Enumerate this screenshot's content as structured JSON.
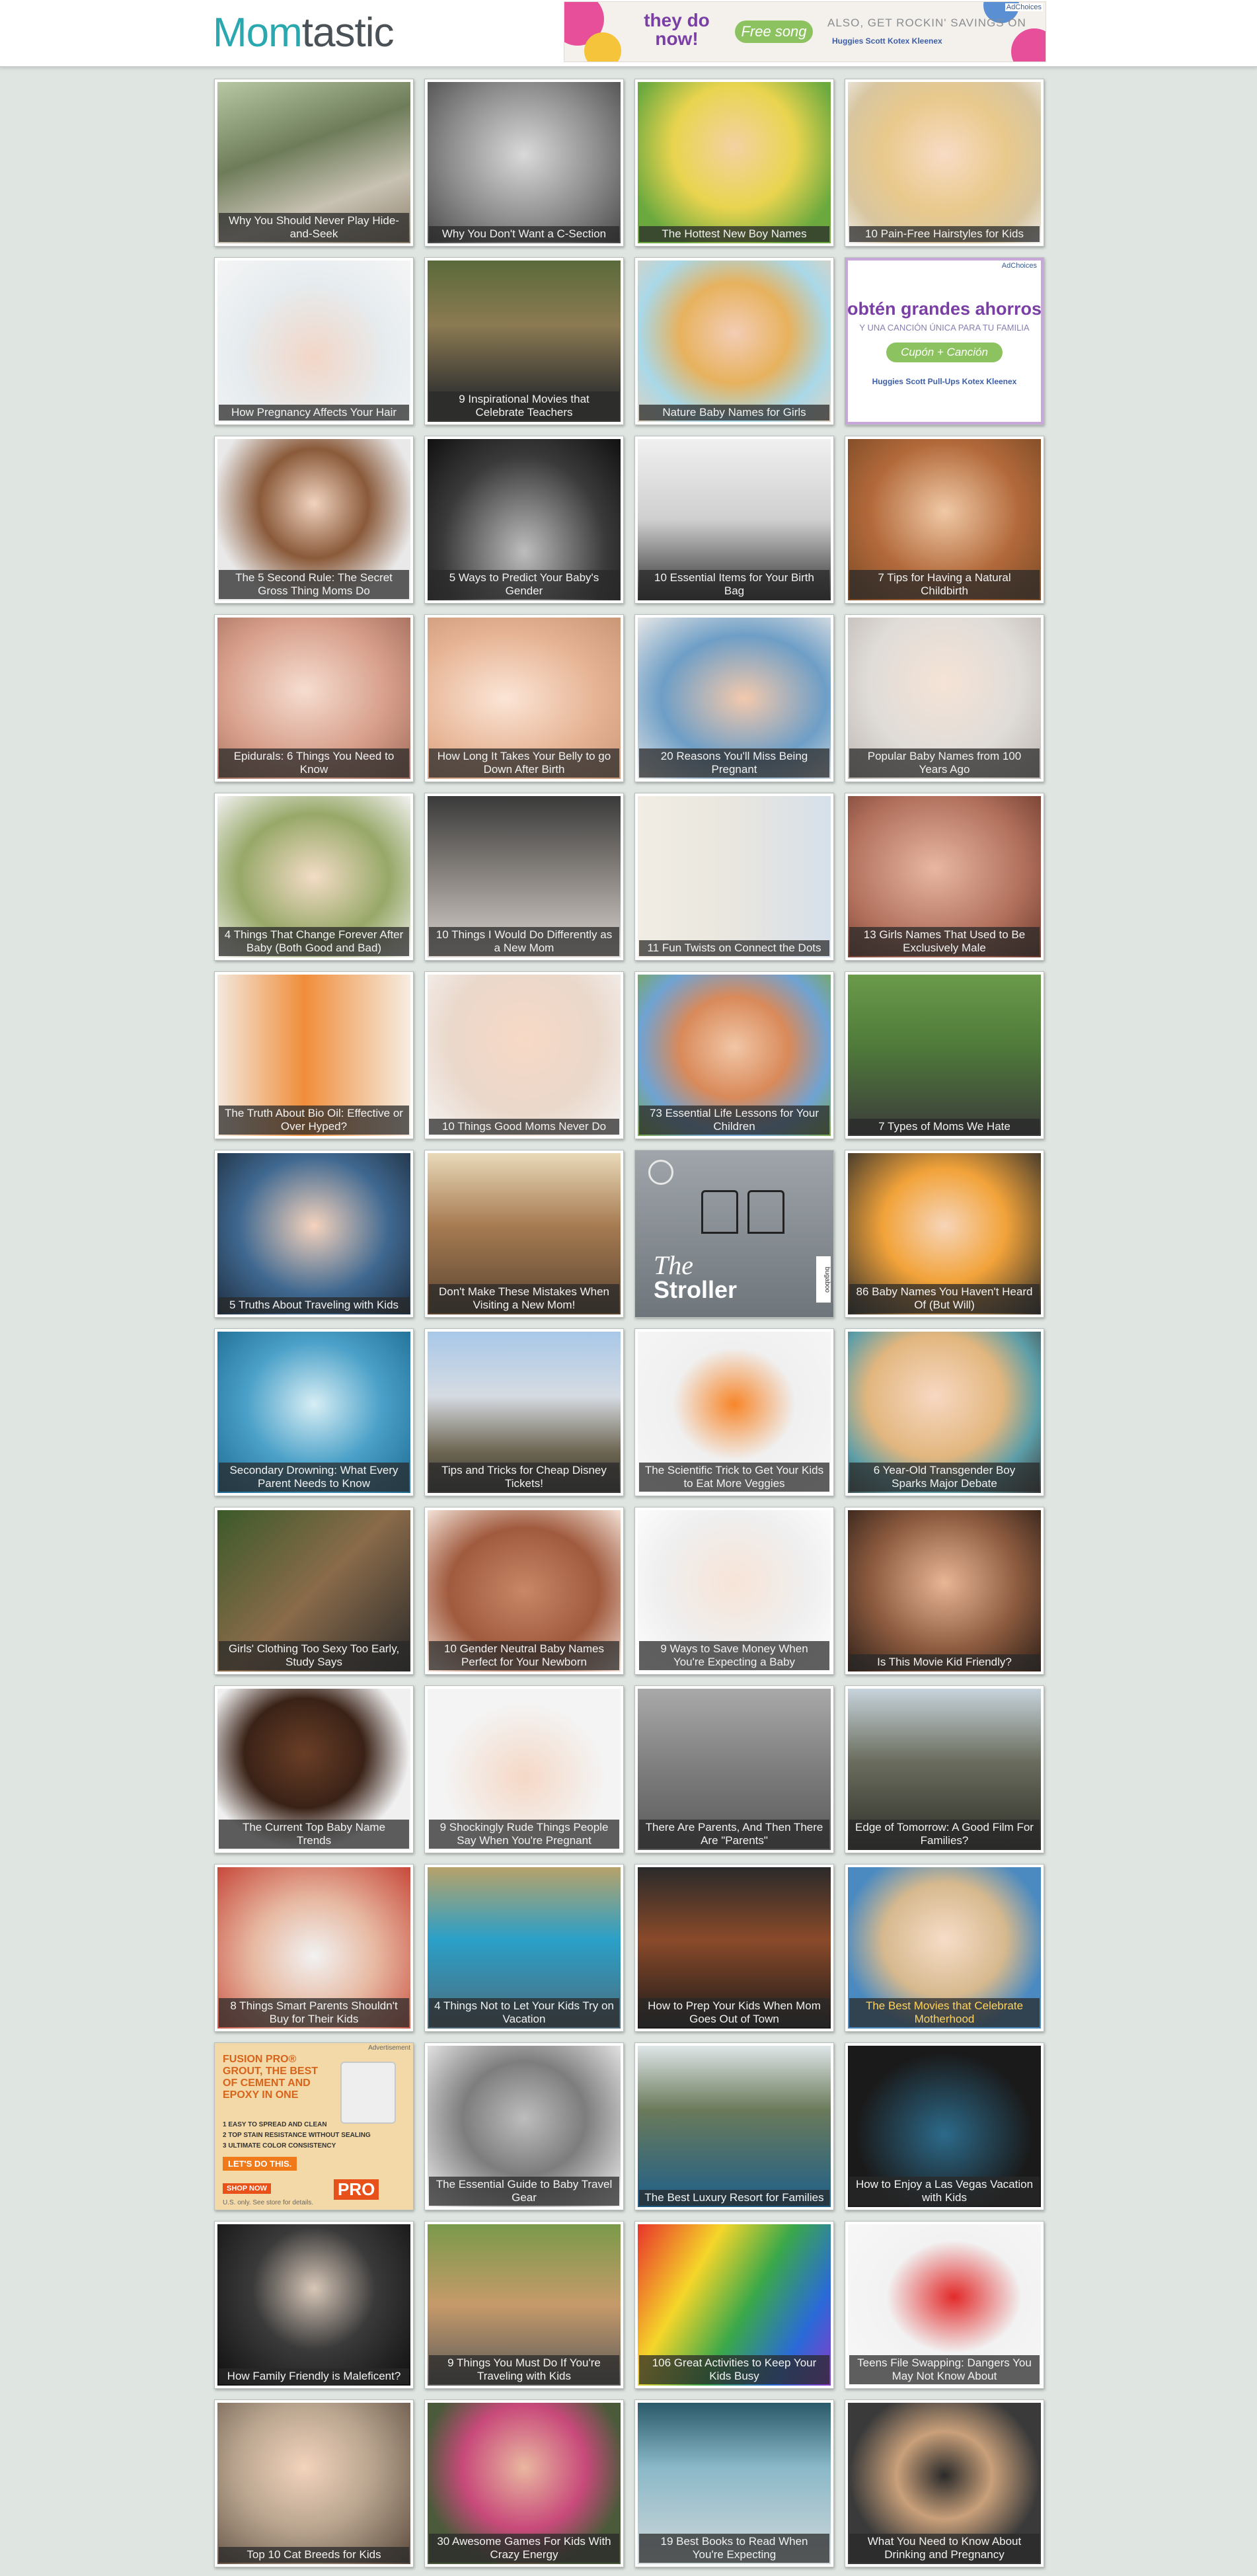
{
  "header": {
    "logo_part1": "Mom",
    "logo_part2": "tastic",
    "ad": {
      "adchoices": "AdChoices",
      "headline": "they do now!",
      "pill": "Free song",
      "tagline": "ALSO, GET ROCKIN' SAVINGS ON",
      "brands": "Huggies  Scott  Kotex  Kleenex"
    }
  },
  "colors": {
    "brand_teal": "#2aa8b0",
    "page_bg": "#dfe5e1",
    "caption_bg": "#3a3a3a"
  },
  "tiles": [
    {
      "caption": "Why You Should Never Play Hide-and-Seek",
      "bg": "linear-gradient(160deg,#b7c7a3,#6e7c5a 40%,#c8c2b2 70%,#8a7d6b)"
    },
    {
      "caption": "Why You Don't Want a C-Section",
      "bg": "radial-gradient(ellipse at 50% 45%,#d9d9d9,#8d8d8d 55%,#4a4a4a)"
    },
    {
      "caption": "The Hottest New Boy Names",
      "bg": "radial-gradient(ellipse at 50% 40%,#f4d2a2,#e9d44f 45%,#6ba93f 80%)"
    },
    {
      "caption": "10 Pain-Free Hairstyles for Kids",
      "bg": "radial-gradient(ellipse at 50% 45%,#f8dcc5,#e9c98c 45%,#d8c6a0 75%,#efefef)"
    },
    {
      "caption": "How Pregnancy Affects Your Hair",
      "bg": "radial-gradient(ellipse at 50% 60%,#f2d6c7,#e6ecef 55%,#f5f5f5)"
    },
    {
      "caption": "9 Inspirational Movies that Celebrate Teachers",
      "bg": "linear-gradient(180deg,#5a6a3a,#8b7a52 40%,#3c3a35 80%)"
    },
    {
      "caption": "Nature Baby Names for Girls",
      "bg": "radial-gradient(ellipse at 50% 45%,#f3cdb5,#e7b25e 40%,#a9d8e8 70%,#e0d2c0)"
    },
    {
      "ad": "sidebar_ad"
    },
    {
      "caption": "The 5 Second Rule: The Secret Gross Thing Moms Do",
      "bg": "radial-gradient(ellipse at 50% 40%,#f1d3bf,#8a5a3a 40%,#e9e9e9 75%)"
    },
    {
      "caption": "5 Ways to Predict Your Baby's Gender",
      "bg": "radial-gradient(ellipse at 50% 70%,#bdbdbd,#3a3a3a 60%,#111)"
    },
    {
      "caption": "10 Essential Items for Your Birth Bag",
      "bg": "linear-gradient(180deg,#f0f0f0,#cfcfcf 50%,#2c2c2c)"
    },
    {
      "caption": "7 Tips for Having a Natural Childbirth",
      "bg": "radial-gradient(ellipse at 50% 45%,#f0c9a6,#b2693a 55%,#7a4a26)"
    },
    {
      "caption": "Epidurals: 6 Things You Need to Know",
      "bg": "radial-gradient(ellipse at 45% 45%,#f6ddd0,#d79f8b 55%,#a06a5a)"
    },
    {
      "caption": "How Long It Takes Your Belly to go Down After Birth",
      "bg": "radial-gradient(ellipse at 40% 50%,#fbe5d6,#e7b596 55%,#c99676)"
    },
    {
      "caption": "20 Reasons You'll Miss Being Pregnant",
      "bg": "radial-gradient(ellipse at 55% 50%,#f3c9ad,#6e9ec6 55%,#e6e6e6)"
    },
    {
      "caption": "Popular Baby Names from 100 Years Ago",
      "bg": "radial-gradient(ellipse at 50% 40%,#f5e3d6,#e0dcd8 55%,#bdb7b2)"
    },
    {
      "caption": "4 Things That Change Forever After Baby (Both Good and Bad)",
      "bg": "radial-gradient(ellipse at 50% 50%,#f3dcc6,#97a868 55%,#f2f2f2)"
    },
    {
      "caption": "10 Things I Would Do Differently as a New Mom",
      "bg": "linear-gradient(180deg,#3a3a3a,#8a8580 50%,#d9d4cf)"
    },
    {
      "caption": "11 Fun Twists on Connect the Dots",
      "bg": "linear-gradient(90deg,#f1ede4,#e9e6df 50%,#d6e0ea)"
    },
    {
      "caption": "13 Girls Names That Used to Be Exclusively Male",
      "bg": "radial-gradient(ellipse at 45% 45%,#e8b7a2,#b06f5b 60%,#6e3b2e)"
    },
    {
      "caption": "The Truth About Bio Oil: Effective or Over Hyped?",
      "bg": "linear-gradient(90deg,#f3e8dd,#f08d3a 45%,#f6ede2)"
    },
    {
      "caption": "10 Things Good Moms Never Do",
      "bg": "radial-gradient(ellipse at 50% 40%,#f7d9c5,#ead8cb 55%,#f4f4f4)"
    },
    {
      "caption": "73 Essential Life Lessons for Your Children",
      "bg": "radial-gradient(ellipse at 50% 45%,#f1c6a6,#d98a5a 40%,#6fa3d3 70%,#7aa84a)"
    },
    {
      "caption": "7 Types of Moms We Hate",
      "bg": "linear-gradient(180deg,#6a9a4a,#4f7a3a 45%,#3b3b3b)"
    },
    {
      "caption": "5 Truths About Traveling with Kids",
      "bg": "radial-gradient(ellipse at 50% 45%,#f5d3bd,#3f6890 55%,#1e2d3e)"
    },
    {
      "caption": "Don't Make These Mistakes When Visiting a New Mom!",
      "bg": "linear-gradient(180deg,#e9d9b8,#a67b52 45%,#5a4430)"
    },
    {
      "ad": "stroller_ad"
    },
    {
      "caption": "86 Baby Names You Haven't Heard Of (But Will)",
      "bg": "radial-gradient(ellipse at 50% 45%,#f6d5b9,#f2a33a 45%,#2a2a2a)"
    },
    {
      "caption": "Secondary Drowning: What Every Parent Needs to Know",
      "bg": "radial-gradient(ellipse at 50% 45%,#d7eef5,#4aa0c8 50%,#1d6a92)"
    },
    {
      "caption": "Tips and Tricks for Cheap Disney Tickets!",
      "bg": "linear-gradient(180deg,#a8c8e8,#d6dbe2 40%,#6b6450 75%,#3a3a3a)"
    },
    {
      "caption": "The Scientific Trick to Get Your Kids to Eat More Veggies",
      "bg": "radial-gradient(ellipse at 50% 45%,#f7862a,#f0f0f0 45%,#f6f6f6)"
    },
    {
      "caption": "6 Year-Old Transgender Boy Sparks Major Debate",
      "bg": "radial-gradient(ellipse at 45% 40%,#f7d8c2,#e2b67e 45%,#5c9ea8 70%,#3a3a3a)"
    },
    {
      "caption": "Girls' Clothing Too Sexy Too Early, Study Says",
      "bg": "linear-gradient(135deg,#3c5a2a,#8a6b4a 50%,#2a2a2a)"
    },
    {
      "caption": "10 Gender Neutral Baby Names Perfect for Your Newborn",
      "bg": "radial-gradient(ellipse at 50% 50%,#c98767,#a05a3e 55%,#f3e1d6)"
    },
    {
      "caption": "9 Ways to Save Money When You're Expecting a Baby",
      "bg": "radial-gradient(ellipse at 50% 45%,#f7e4d7,#efefef 55%,#ffffff)"
    },
    {
      "caption": "Is This Movie Kid Friendly?",
      "bg": "radial-gradient(ellipse at 50% 45%,#e8b595,#8b5a3e 55%,#2d1f18)"
    },
    {
      "caption": "The Current Top Baby Name Trends",
      "bg": "radial-gradient(ellipse at 45% 40%,#6a3e26,#3a2217 40%,#f0f0f0 70%)"
    },
    {
      "caption": "9 Shockingly Rude Things People Say When You're Pregnant",
      "bg": "radial-gradient(ellipse at 50% 55%,#f5d8c6,#f4f4f4 60%)"
    },
    {
      "caption": "There Are Parents, And Then There Are \"Parents\"",
      "bg": "linear-gradient(180deg,#a9a9a9,#7d7d7d 50%,#5a5a5a)"
    },
    {
      "caption": "Edge of Tomorrow: A Good Film For Families?",
      "bg": "linear-gradient(180deg,#c7d3db,#6a6d5e 45%,#2e2f29)"
    },
    {
      "caption": "8 Things Smart Parents Shouldn't Buy for Their Kids",
      "bg": "radial-gradient(ellipse at 50% 55%,#f2f2f2,#e7b9a2 45%,#c7483a)"
    },
    {
      "caption": "4 Things Not to Let Your Kids Try on Vacation",
      "bg": "linear-gradient(180deg,#b7a26a,#2aa0c8 45%,#4d6a7a)"
    },
    {
      "caption": "How to Prep Your Kids When Mom Goes Out of Town",
      "bg": "linear-gradient(180deg,#2a2a2a,#8a4a2a 45%,#1a1a1a)"
    },
    {
      "caption": "The Best Movies that Celebrate Motherhood",
      "hl": true,
      "bg": "radial-gradient(ellipse at 50% 45%,#f7ddc8,#d6b98e 45%,#4a8ac0 75%)"
    },
    {
      "ad": "fusion_ad"
    },
    {
      "caption": "The Essential Guide to Baby Travel Gear",
      "bg": "radial-gradient(ellipse at 50% 45%,#bdbdbd,#7d7d7d 45%,#f4f4f4)"
    },
    {
      "caption": "The Best Luxury Resort for Families",
      "bg": "linear-gradient(180deg,#dfe6e8,#6a7a5a 40%,#1e5f8a)"
    },
    {
      "caption": "How to Enjoy a Las Vegas Vacation with Kids",
      "bg": "radial-gradient(ellipse at 50% 55%,#2c6a8a,#1a1a1a 65%)"
    },
    {
      "caption": "How Family Friendly is Maleficent?",
      "bg": "radial-gradient(ellipse at 50% 40%,#d8c7b8,#3a3a3a 45%,#0f0f0f)"
    },
    {
      "caption": "9 Things You Must Do If You're Traveling with Kids",
      "bg": "linear-gradient(180deg,#7a9a4a,#c69a6a 50%,#5a5a5a)"
    },
    {
      "caption": "106 Great Activities to Keep Your Kids Busy",
      "bg": "linear-gradient(120deg,#e8342a,#f5d62a 30%,#3aa84a 55%,#2a6ad8 80%,#8a3ac8)"
    },
    {
      "caption": "Teens File Swapping: Dangers You May Not Know About",
      "bg": "radial-gradient(ellipse at 55% 45%,#e22a2a,#f2f2f2 45%,#f8f8f8)"
    },
    {
      "caption": "Top 10 Cat Breeds for Kids",
      "bg": "radial-gradient(ellipse at 45% 40%,#f3d3bc,#b9a58f 45%,#5a4a3e)"
    },
    {
      "caption": "30 Awesome Games For Kids With Crazy Energy",
      "bg": "radial-gradient(ellipse at 50% 40%,#e9b7a0,#c84a7a 45%,#4a5a3a 75%)"
    },
    {
      "caption": "19 Best Books to Read When You're Expecting",
      "bg": "linear-gradient(180deg,#2a5a6a,#8ab8c8 40%,#d0d8da)"
    },
    {
      "caption": "What You Need to Know About Drinking and Pregnancy",
      "bg": "radial-gradient(ellipse at 50% 45%,#2a2a2a,#c9a07a 35%,#3a3a3a 70%)"
    }
  ],
  "ads": {
    "sidebar_ad": {
      "adchoices": "AdChoices",
      "line1": "obtén grandes ahorros",
      "line2": "Y UNA CANCIÓN ÚNICA PARA TU FAMILIA",
      "pill": "Cupón + Canción",
      "brands": "Huggies  Scott  Pull-Ups  Kotex  Kleenex"
    },
    "stroller_ad": {
      "title_italic": "The",
      "title": "Stroller",
      "side": "bugaboo"
    },
    "fusion_ad": {
      "advert": "Advertisement",
      "headline": "FUSION PRO® GROUT, THE BEST OF CEMENT AND EPOXY IN ONE",
      "b1": "1 EASY TO SPREAD AND CLEAN",
      "b2": "2 TOP STAIN RESISTANCE WITHOUT SEALING",
      "b3": "3 ULTIMATE COLOR CONSISTENCY",
      "cta": "LET'S DO THIS.",
      "shop": "SHOP NOW",
      "logo": "PRO",
      "small": "U.S. only. See store for details."
    }
  }
}
